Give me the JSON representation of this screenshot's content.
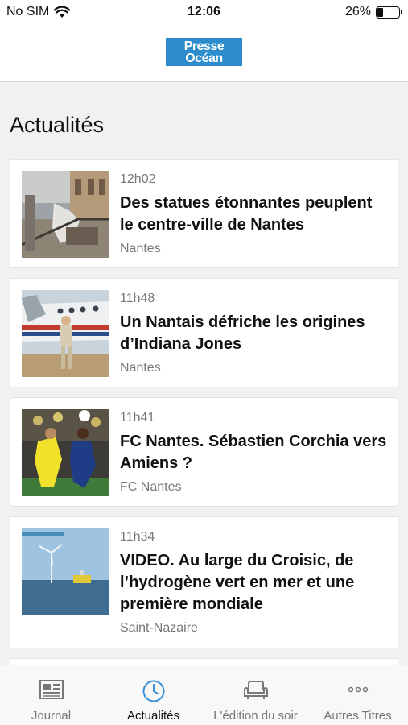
{
  "status": {
    "carrier": "No SIM",
    "time": "12:06",
    "battery_text": "26%",
    "battery_level": 0.26
  },
  "header": {
    "logo_line1": "Presse",
    "logo_line2": "Océan",
    "logo_color": "#2d8ccc"
  },
  "page": {
    "title": "Actualités"
  },
  "articles": [
    {
      "time": "12h02",
      "title": "Des statues étonnantes peuplent le centre-ville de Nantes",
      "category": "Nantes",
      "image": "street-statues"
    },
    {
      "time": "11h48",
      "title": "Un Nantais défriche les origines d’Indiana Jones",
      "category": "Nantes",
      "image": "man-with-airplane"
    },
    {
      "time": "11h41",
      "title": "FC Nantes. Sébastien Corchia vers Amiens ?",
      "category": "FC Nantes",
      "image": "football-players"
    },
    {
      "time": "11h34",
      "title": "VIDEO. Au large du Croisic, de l’hydrogène vert en mer et une première mondiale",
      "category": "Saint-Nazaire",
      "image": "offshore-wind-turbine"
    }
  ],
  "tabs": [
    {
      "label": "Journal",
      "icon": "newspaper-icon"
    },
    {
      "label": "Actualités",
      "icon": "clock-icon",
      "active": true
    },
    {
      "label": "L'édition du soir",
      "icon": "armchair-icon"
    },
    {
      "label": "Autres Titres",
      "icon": "more-dots-icon"
    }
  ],
  "colors": {
    "active_tab_icon": "#3b8fd6",
    "background": "#f1f1f2"
  }
}
